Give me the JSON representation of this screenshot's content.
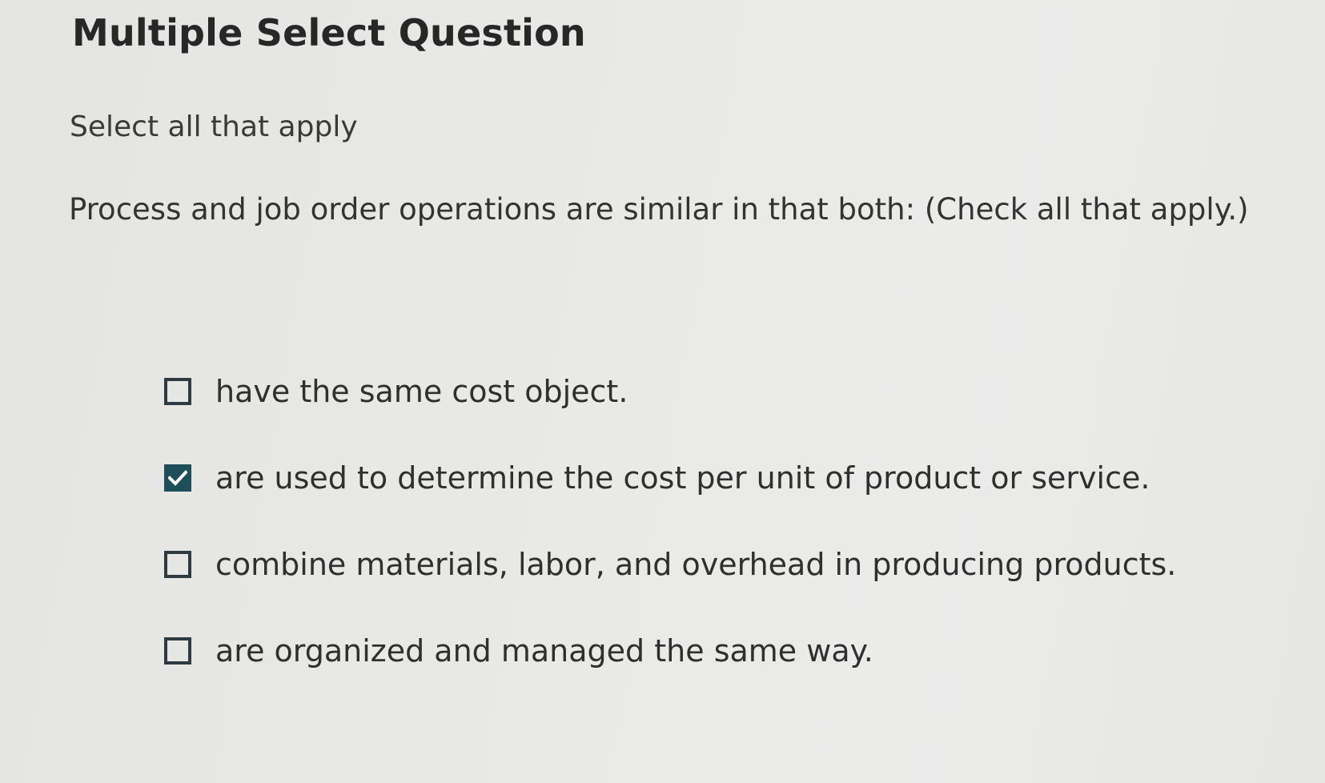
{
  "question": {
    "title": "Multiple Select Question",
    "instruction": "Select all that apply",
    "prompt": "Process and job order operations are similar in that both: (Check all that apply.)"
  },
  "options": [
    {
      "label": "have the same cost object.",
      "checked": false
    },
    {
      "label": "are used to determine the cost per unit of product or service.",
      "checked": true
    },
    {
      "label": "combine materials, labor, and overhead in producing products.",
      "checked": false
    },
    {
      "label": "are organized and managed the same way.",
      "checked": false
    }
  ],
  "colors": {
    "checkbox_checked": "#1e4e5a",
    "checkbox_border": "#2e3a3f",
    "background": "#e8e8e6"
  },
  "icons": {
    "check": "checkmark-icon"
  }
}
